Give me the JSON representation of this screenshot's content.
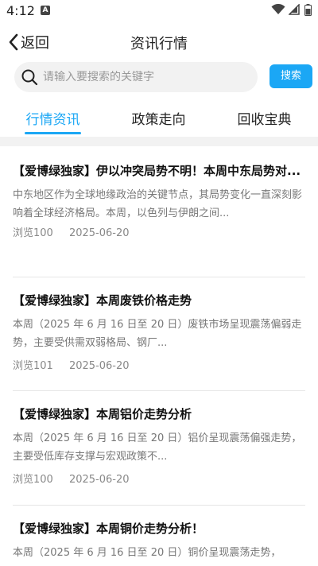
{
  "status": {
    "time": "4:12",
    "notification_glyph": "A"
  },
  "header": {
    "back_label": "返回",
    "title": "资讯行情"
  },
  "search": {
    "placeholder": "请输入要搜索的关键字",
    "button_label": "搜索"
  },
  "tabs": [
    {
      "label": "行情资讯",
      "active": true
    },
    {
      "label": "政策走向",
      "active": false
    },
    {
      "label": "回收宝典",
      "active": false
    }
  ],
  "colors": {
    "accent": "#1ba7f5",
    "band": "#f2f2f2"
  },
  "news": [
    {
      "title": "【爱博绿独家】伊以冲突局势不明！本周中东局势对...",
      "summary": "中东地区作为全球地缘政治的关键节点，其局势变化一直深刻影响着全球经济格局。本周，以色列与伊朗之间...",
      "views": "浏览100",
      "date": "2025-06-20"
    },
    {
      "title": "【爱博绿独家】本周废铁价格走势",
      "summary": "本周（2025 年 6 月 16 日至 20 日）废铁市场呈现震荡偏弱走势，主要受供需双弱格局、钢厂...",
      "views": "浏览101",
      "date": "2025-06-20"
    },
    {
      "title": "【爱博绿独家】本周铝价走势分析",
      "summary": "本周（2025 年 6 月 16 日至 20 日）铝价呈现震荡偏强走势，主要受低库存支撑与宏观政策不...",
      "views": "浏览100",
      "date": "2025-06-20"
    },
    {
      "title": "【爱博绿独家】本周铜价走势分析！",
      "summary": "本周（2025 年 6 月 16 日至 20 日）铜价呈现震荡走势，",
      "views": "",
      "date": ""
    }
  ]
}
